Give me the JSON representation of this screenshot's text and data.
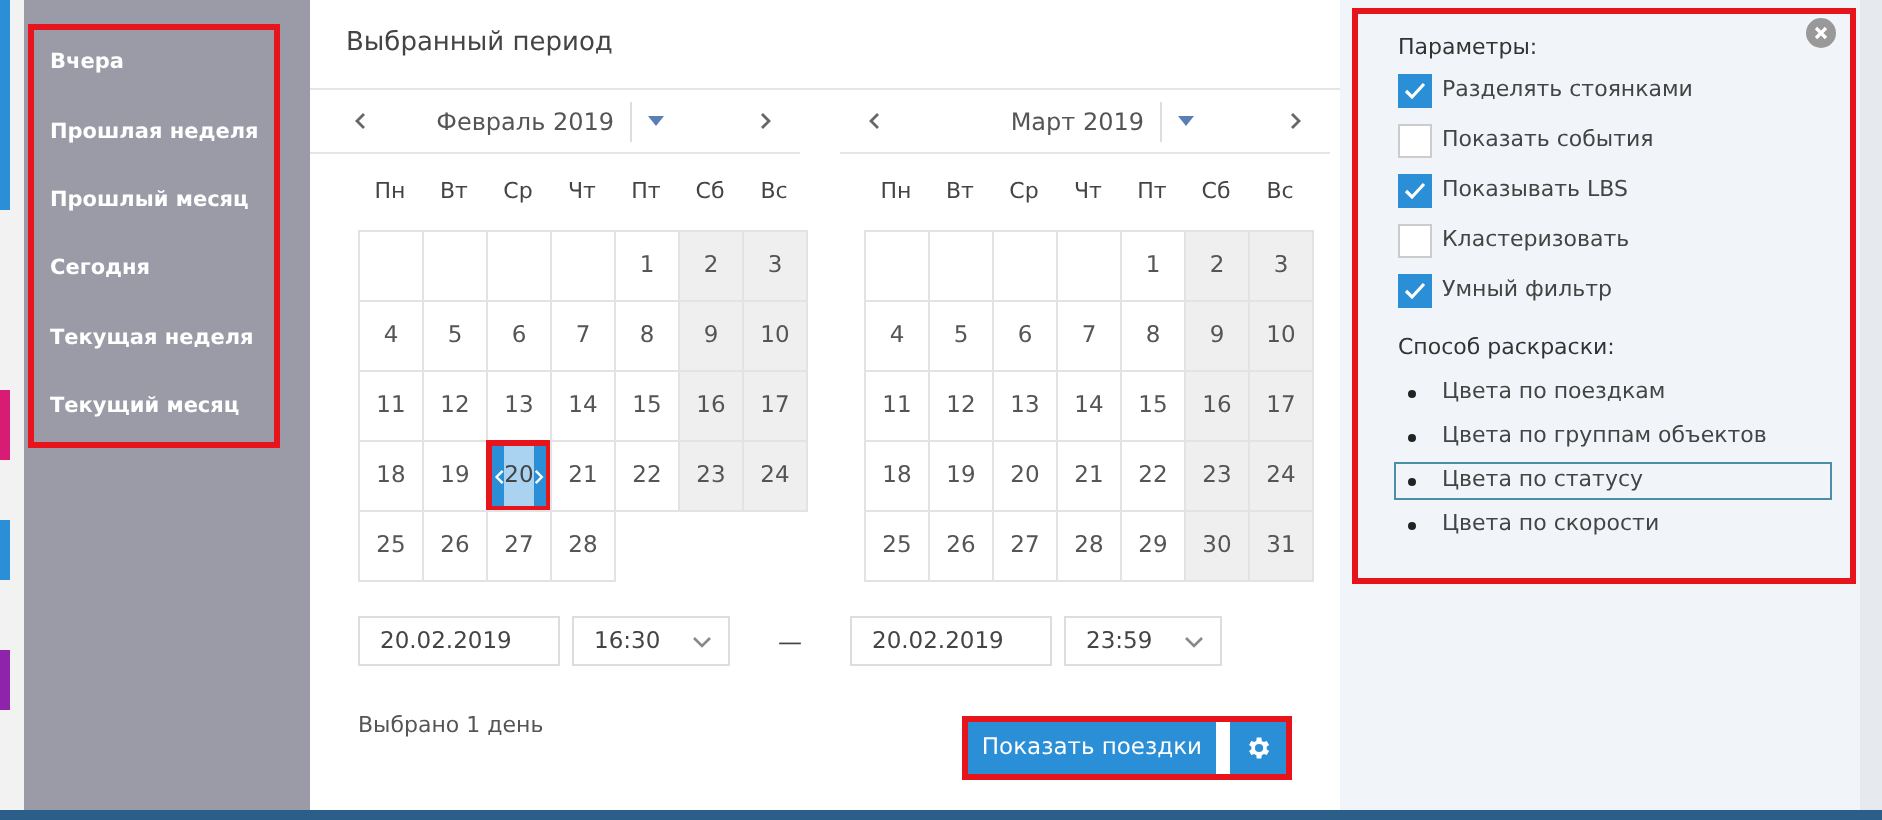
{
  "presets": [
    {
      "label": "Вчера"
    },
    {
      "label": "Прошлая неделя"
    },
    {
      "label": "Прошлый месяц"
    },
    {
      "label": "Сегодня"
    },
    {
      "label": "Текущая неделя"
    },
    {
      "label": "Текущий месяц"
    }
  ],
  "period": {
    "title": "Выбранный период",
    "months": [
      {
        "title": "Февраль 2019",
        "weekdays": [
          "Пн",
          "Вт",
          "Ср",
          "Чт",
          "Пт",
          "Сб",
          "Вс"
        ],
        "weeks": [
          [
            {
              "kind": "blank"
            },
            {
              "kind": "blank"
            },
            {
              "kind": "blank"
            },
            {
              "kind": "blank"
            },
            {
              "kind": "day",
              "day": "1",
              "selected": false
            },
            {
              "kind": "day",
              "day": "2",
              "selected": false
            },
            {
              "kind": "day",
              "day": "3",
              "selected": false
            }
          ],
          [
            {
              "kind": "day",
              "day": "4",
              "selected": false
            },
            {
              "kind": "day",
              "day": "5",
              "selected": false
            },
            {
              "kind": "day",
              "day": "6",
              "selected": false
            },
            {
              "kind": "day",
              "day": "7",
              "selected": false
            },
            {
              "kind": "day",
              "day": "8",
              "selected": false
            },
            {
              "kind": "day",
              "day": "9",
              "selected": false
            },
            {
              "kind": "day",
              "day": "10",
              "selected": false
            }
          ],
          [
            {
              "kind": "day",
              "day": "11",
              "selected": false
            },
            {
              "kind": "day",
              "day": "12",
              "selected": false
            },
            {
              "kind": "day",
              "day": "13",
              "selected": false
            },
            {
              "kind": "day",
              "day": "14",
              "selected": false
            },
            {
              "kind": "day",
              "day": "15",
              "selected": false
            },
            {
              "kind": "day",
              "day": "16",
              "selected": false
            },
            {
              "kind": "day",
              "day": "17",
              "selected": false
            }
          ],
          [
            {
              "kind": "day",
              "day": "18",
              "selected": false
            },
            {
              "kind": "day",
              "day": "19",
              "selected": false
            },
            {
              "kind": "day",
              "day": "20",
              "selected": true
            },
            {
              "kind": "day",
              "day": "21",
              "selected": false
            },
            {
              "kind": "day",
              "day": "22",
              "selected": false
            },
            {
              "kind": "day",
              "day": "23",
              "selected": false
            },
            {
              "kind": "day",
              "day": "24",
              "selected": false
            }
          ],
          [
            {
              "kind": "day",
              "day": "25",
              "selected": false
            },
            {
              "kind": "day",
              "day": "26",
              "selected": false
            },
            {
              "kind": "day",
              "day": "27",
              "selected": false
            },
            {
              "kind": "day",
              "day": "28",
              "selected": false
            }
          ]
        ]
      },
      {
        "title": "Март 2019",
        "weekdays": [
          "Пн",
          "Вт",
          "Ср",
          "Чт",
          "Пт",
          "Сб",
          "Вс"
        ],
        "weeks": [
          [
            {
              "kind": "blank"
            },
            {
              "kind": "blank"
            },
            {
              "kind": "blank"
            },
            {
              "kind": "blank"
            },
            {
              "kind": "day",
              "day": "1",
              "selected": false
            },
            {
              "kind": "day",
              "day": "2",
              "selected": false
            },
            {
              "kind": "day",
              "day": "3",
              "selected": false
            }
          ],
          [
            {
              "kind": "day",
              "day": "4",
              "selected": false
            },
            {
              "kind": "day",
              "day": "5",
              "selected": false
            },
            {
              "kind": "day",
              "day": "6",
              "selected": false
            },
            {
              "kind": "day",
              "day": "7",
              "selected": false
            },
            {
              "kind": "day",
              "day": "8",
              "selected": false
            },
            {
              "kind": "day",
              "day": "9",
              "selected": false
            },
            {
              "kind": "day",
              "day": "10",
              "selected": false
            }
          ],
          [
            {
              "kind": "day",
              "day": "11",
              "selected": false
            },
            {
              "kind": "day",
              "day": "12",
              "selected": false
            },
            {
              "kind": "day",
              "day": "13",
              "selected": false
            },
            {
              "kind": "day",
              "day": "14",
              "selected": false
            },
            {
              "kind": "day",
              "day": "15",
              "selected": false
            },
            {
              "kind": "day",
              "day": "16",
              "selected": false
            },
            {
              "kind": "day",
              "day": "17",
              "selected": false
            }
          ],
          [
            {
              "kind": "day",
              "day": "18",
              "selected": false
            },
            {
              "kind": "day",
              "day": "19",
              "selected": false
            },
            {
              "kind": "day",
              "day": "20",
              "selected": false
            },
            {
              "kind": "day",
              "day": "21",
              "selected": false
            },
            {
              "kind": "day",
              "day": "22",
              "selected": false
            },
            {
              "kind": "day",
              "day": "23",
              "selected": false
            },
            {
              "kind": "day",
              "day": "24",
              "selected": false
            }
          ],
          [
            {
              "kind": "day",
              "day": "25",
              "selected": false
            },
            {
              "kind": "day",
              "day": "26",
              "selected": false
            },
            {
              "kind": "day",
              "day": "27",
              "selected": false
            },
            {
              "kind": "day",
              "day": "28",
              "selected": false
            },
            {
              "kind": "day",
              "day": "29",
              "selected": false
            },
            {
              "kind": "day",
              "day": "30",
              "selected": false
            },
            {
              "kind": "day",
              "day": "31",
              "selected": false
            }
          ]
        ]
      }
    ],
    "from_date": "20.02.2019",
    "from_time": "16:30",
    "separator": "—",
    "to_date": "20.02.2019",
    "to_time": "23:59",
    "summary": "Выбрано 1 день",
    "show_button": "Показать поездки"
  },
  "params": {
    "title": "Параметры:",
    "options": [
      {
        "label": "Разделять стоянками",
        "checked": true
      },
      {
        "label": "Показать события",
        "checked": false
      },
      {
        "label": "Показывать LBS",
        "checked": true
      },
      {
        "label": "Кластеризовать",
        "checked": false
      },
      {
        "label": "Умный фильтр",
        "checked": true
      }
    ],
    "coloring_title": "Способ раскраски:",
    "coloring": [
      {
        "label": "Цвета по поездкам",
        "selected": false
      },
      {
        "label": "Цвета по группам объектов",
        "selected": false
      },
      {
        "label": "Цвета по статусу",
        "selected": true
      },
      {
        "label": "Цвета по скорости",
        "selected": false
      }
    ]
  }
}
